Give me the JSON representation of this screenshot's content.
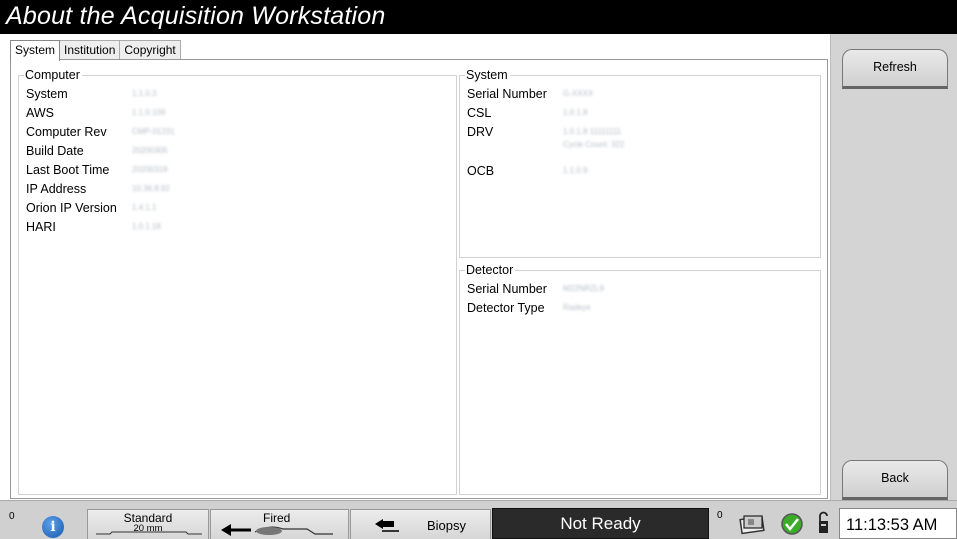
{
  "window": {
    "title": "About the Acquisition Workstation"
  },
  "tabs": [
    {
      "label": "System",
      "active": true
    },
    {
      "label": "Institution",
      "active": false
    },
    {
      "label": "Copyright",
      "active": false
    }
  ],
  "computer": {
    "legend": "Computer",
    "rows": [
      {
        "label": "System",
        "value": "1.1.0.3"
      },
      {
        "label": "AWS",
        "value": "1.1.0.109"
      },
      {
        "label": "Computer Rev",
        "value": "CMP-01231"
      },
      {
        "label": "Build Date",
        "value": "20200305"
      },
      {
        "label": "Last Boot Time",
        "value": "20200318"
      },
      {
        "label": "IP Address",
        "value": "10.36.8.92"
      },
      {
        "label": "Orion IP Version",
        "value": "1.4.1.1"
      },
      {
        "label": "HARI",
        "value": "1.0.1.18"
      }
    ]
  },
  "system": {
    "legend": "System",
    "rows": [
      {
        "label": "Serial Number",
        "value": "G-XXXX"
      },
      {
        "label": "CSL",
        "value": "1.0.1.8"
      },
      {
        "label": "DRV",
        "value": "1.0.1.8   11111111",
        "value2": "Cycle Count: 322"
      },
      {
        "label": "OCB",
        "value": "1.1.0.9"
      }
    ]
  },
  "detector": {
    "legend": "Detector",
    "rows": [
      {
        "label": "Serial Number",
        "value": "M22NRZL9"
      },
      {
        "label": "Detector Type",
        "value": "Radeye"
      }
    ]
  },
  "sidebar": {
    "refresh_label": "Refresh",
    "back_label": "Back"
  },
  "statusbar": {
    "left_count": "0",
    "info_icon_glyph": "i",
    "standard_label": "Standard",
    "standard_sub": "20 mm",
    "fired_label": "Fired",
    "biopsy_label": "Biopsy",
    "status_text": "Not Ready",
    "right_count": "0",
    "clock": "11:13:53 AM"
  },
  "colors": {
    "titlebar_bg": "#000000",
    "sidebar_bg": "#d4d4d4",
    "status_ready_bg": "#2a2a2a",
    "check_green": "#3cab2a",
    "info_blue": "#1f6fcf"
  },
  "icons": [
    "info-icon",
    "compression-paddle-icon",
    "fired-arrow-icon",
    "biopsy-icon",
    "image-stack-icon",
    "checkmark-icon",
    "lock-icon"
  ]
}
